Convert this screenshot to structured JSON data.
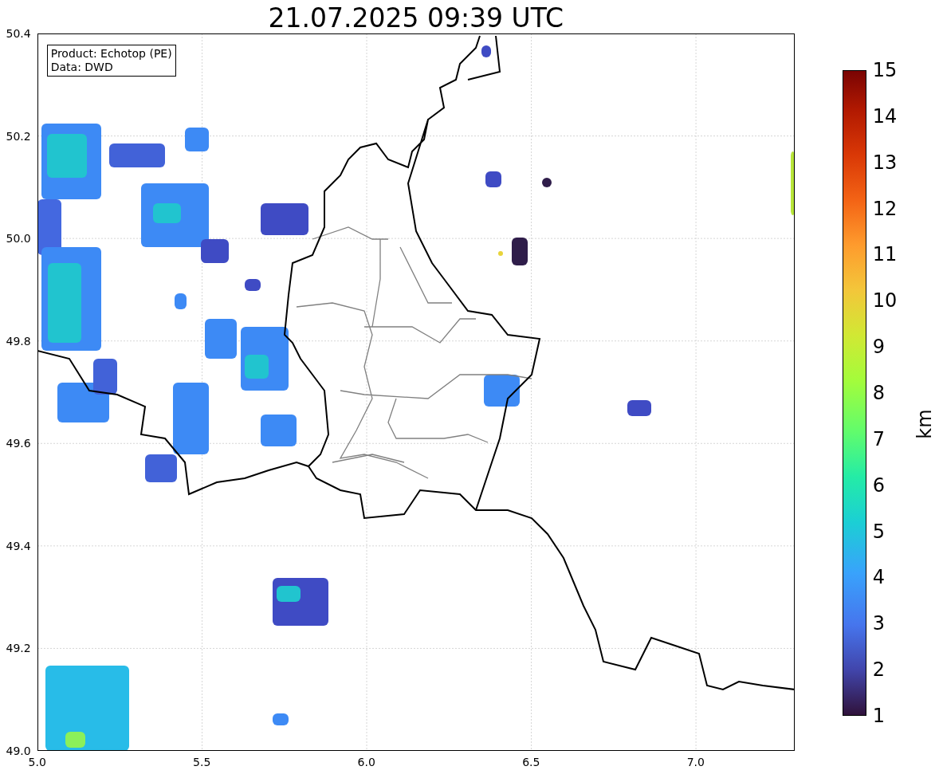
{
  "title": "21.07.2025 09:39 UTC",
  "legend": [
    "Product: Echotop (PE)",
    "Data: DWD"
  ],
  "x_ticks": [
    "5.0",
    "5.5",
    "6.0",
    "6.5",
    "7.0"
  ],
  "y_ticks": [
    "50.4",
    "50.2",
    "50.0",
    "49.8",
    "49.6",
    "49.4",
    "49.2",
    "49.0"
  ],
  "colorbar": {
    "label": "km",
    "ticks": [
      "15",
      "14",
      "13",
      "12",
      "11",
      "10",
      "9",
      "8",
      "7",
      "6",
      "5",
      "4",
      "3",
      "2",
      "1"
    ]
  }
}
